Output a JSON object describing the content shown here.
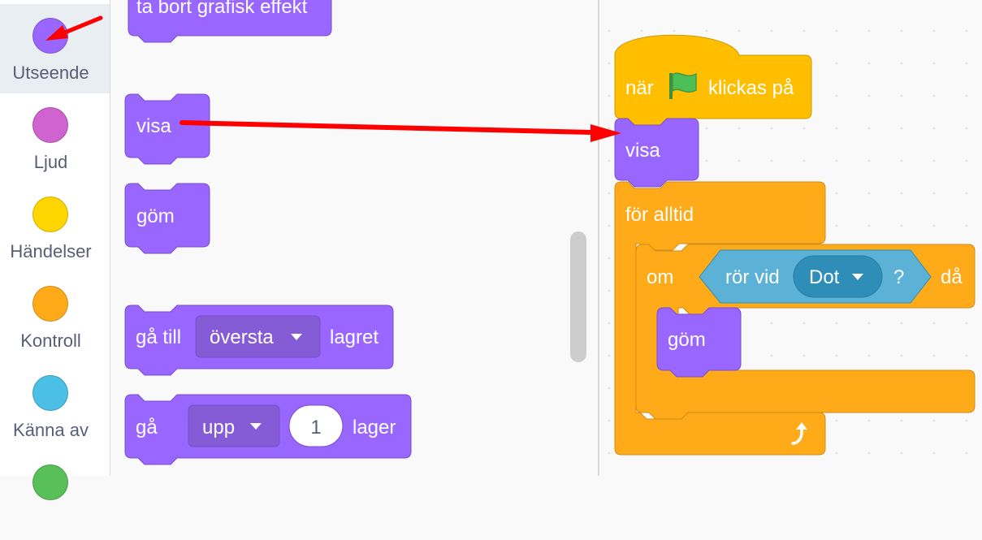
{
  "categories": [
    {
      "label": "Utseende",
      "color": "#9966ff",
      "selected": true
    },
    {
      "label": "Ljud",
      "color": "#cf63cf"
    },
    {
      "label": "Händelser",
      "color": "#ffd500"
    },
    {
      "label": "Kontroll",
      "color": "#ffab19"
    },
    {
      "label": "Känna av",
      "color": "#4cbfe6"
    },
    {
      "label": "",
      "color": "#59c059"
    }
  ],
  "palette": {
    "clear_effects": "ta bort grafisk effekt",
    "show": "visa",
    "hide": "göm",
    "go_to_layer": {
      "prefix": "gå till",
      "dropdown": "översta",
      "suffix": "lagret"
    },
    "go_layers": {
      "prefix": "gå",
      "dropdown": "upp",
      "number": "1",
      "suffix": "lager"
    }
  },
  "script": {
    "when_flag": {
      "prefix": "när",
      "suffix": "klickas på"
    },
    "show": "visa",
    "forever": "för alltid",
    "if_block": {
      "prefix": "om",
      "suffix": "då"
    },
    "touching": {
      "prefix": "rör vid",
      "dropdown": "Dot",
      "question": "?"
    },
    "hide": "göm"
  },
  "colors": {
    "looks": "#9966ff",
    "events": "#ffbf00",
    "control": "#ffab19",
    "sensing": "#5cb1d6",
    "arrow": "#ff0000"
  }
}
